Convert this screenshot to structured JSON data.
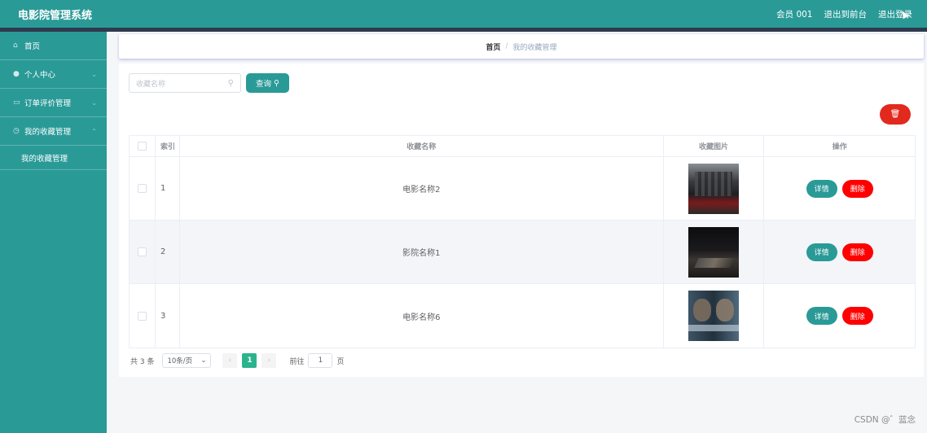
{
  "app": {
    "title": "电影院管理系统"
  },
  "top_actions": {
    "member": "会员 001",
    "front": "退出到前台",
    "logout": "退出登录"
  },
  "sidebar": {
    "items": [
      {
        "label": "首页",
        "icon": "home-icon"
      },
      {
        "label": "个人中心",
        "icon": "user-icon"
      },
      {
        "label": "订单评价管理",
        "icon": "calendar-icon"
      },
      {
        "label": "我的收藏管理",
        "icon": "clock-icon"
      }
    ],
    "sub_item": "我的收藏管理"
  },
  "breadcrumb": {
    "home": "首页",
    "sep": "/",
    "current": "我的收藏管理"
  },
  "search": {
    "placeholder": "收藏名称",
    "button": "查询"
  },
  "table": {
    "headers": {
      "index": "索引",
      "name": "收藏名称",
      "image": "收藏图片",
      "op": "操作"
    },
    "rows": [
      {
        "index": "1",
        "name": "电影名称2"
      },
      {
        "index": "2",
        "name": "影院名称1"
      },
      {
        "index": "3",
        "name": "电影名称6"
      }
    ],
    "detail_label": "详情",
    "delete_label": "删除"
  },
  "pagination": {
    "total": "共 3 条",
    "page_size": "10条/页",
    "current": "1",
    "goto_prefix": "前往",
    "goto_value": "1",
    "goto_suffix": "页"
  },
  "watermark": "CSDN @゛蓝念",
  "colors": {
    "primary": "#2a9a97",
    "danger": "#ff0000",
    "page_active": "#2bb38d"
  }
}
